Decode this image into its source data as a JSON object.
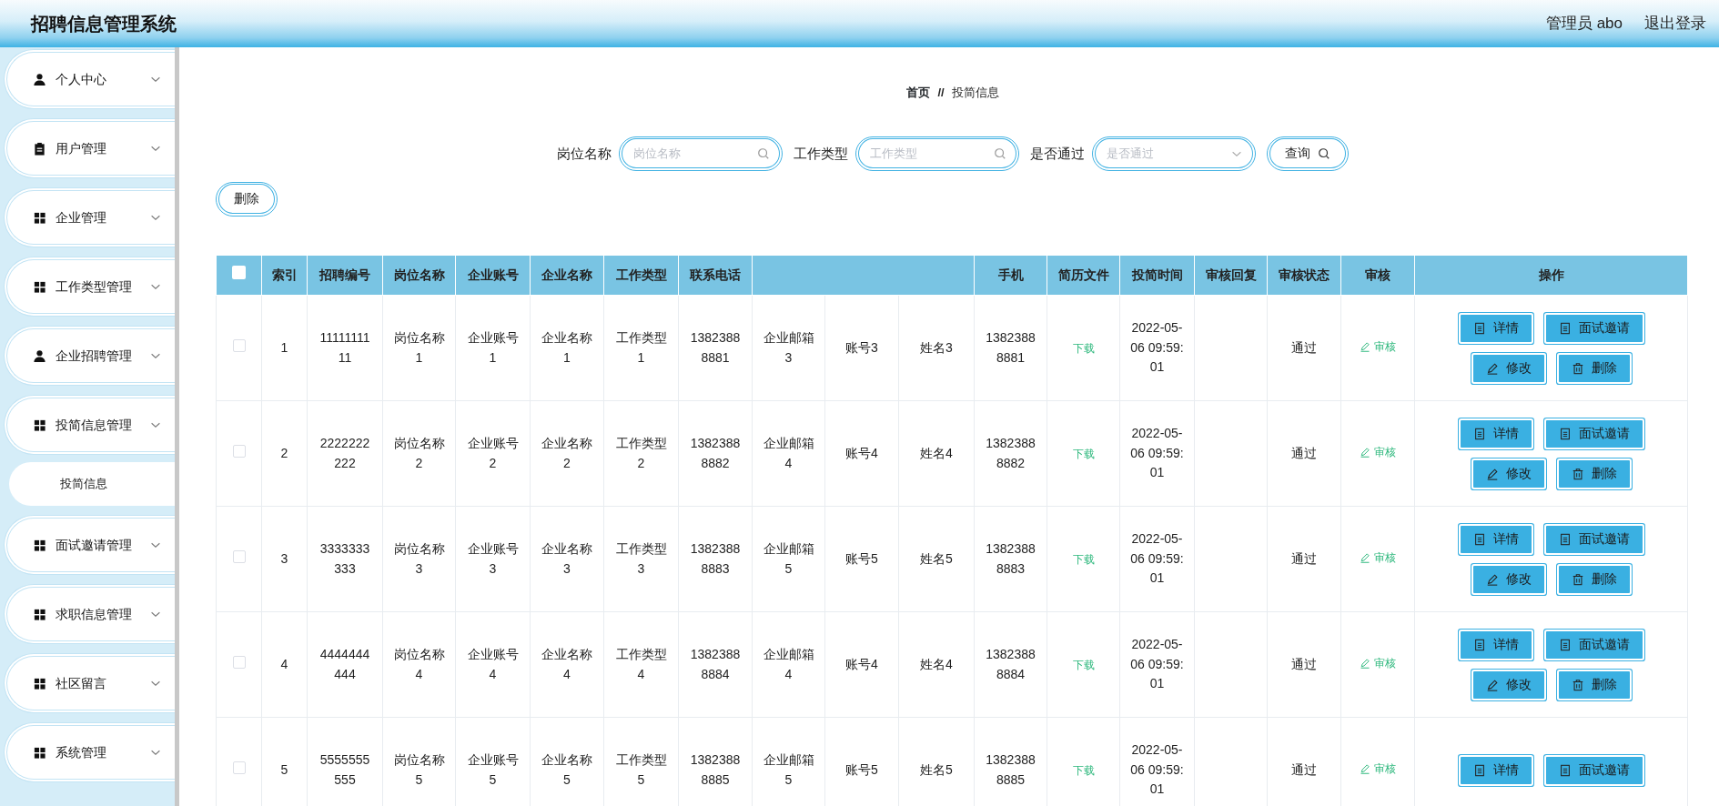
{
  "header": {
    "title": "招聘信息管理系统",
    "user": "管理员 abo",
    "logout": "退出登录"
  },
  "sidebar": {
    "items": [
      {
        "label": "个人中心"
      },
      {
        "label": "用户管理"
      },
      {
        "label": "企业管理"
      },
      {
        "label": "工作类型管理"
      },
      {
        "label": "企业招聘管理"
      },
      {
        "label": "投简信息管理",
        "children": [
          {
            "label": "投简信息",
            "selected": true
          }
        ]
      },
      {
        "label": "面试邀请管理"
      },
      {
        "label": "求职信息管理"
      },
      {
        "label": "社区留言"
      },
      {
        "label": "系统管理"
      }
    ]
  },
  "breadcrumb": {
    "home": "首页",
    "separator": "//",
    "current": "投简信息"
  },
  "search": {
    "fields": [
      {
        "label": "岗位名称",
        "placeholder": "岗位名称",
        "kind": "text"
      },
      {
        "label": "工作类型",
        "placeholder": "工作类型",
        "kind": "text"
      },
      {
        "label": "是否通过",
        "placeholder": "是否通过",
        "kind": "select"
      }
    ],
    "button": "查询"
  },
  "delete_button": "删除",
  "table": {
    "select_all": {
      "checked": false
    },
    "columns": [
      "索引",
      "招聘编号",
      "岗位名称",
      "企业账号",
      "企业名称",
      "工作类型",
      "联系电话",
      "",
      "",
      "",
      "手机",
      "简历文件",
      "投简时间",
      "审核回复",
      "审核状态",
      "审核",
      "操作"
    ],
    "rows": [
      {
        "checked": false,
        "cells": [
          "1",
          "1111111111",
          "岗位名称1",
          "企业账号1",
          "企业名称1",
          "工作类型1",
          "13823888881",
          "企业邮箱3",
          "账号3",
          "姓名3",
          "13823888881",
          "下载",
          "2022-05-06 09:59:01",
          "",
          "通过",
          "审核"
        ],
        "actions": [
          "详情",
          "面试邀请",
          "修改",
          "删除"
        ]
      },
      {
        "checked": false,
        "cells": [
          "2",
          "2222222222",
          "岗位名称2",
          "企业账号2",
          "企业名称2",
          "工作类型2",
          "13823888882",
          "企业邮箱4",
          "账号4",
          "姓名4",
          "13823888882",
          "下载",
          "2022-05-06 09:59:01",
          "",
          "通过",
          "审核"
        ],
        "actions": [
          "详情",
          "面试邀请",
          "修改",
          "删除"
        ]
      },
      {
        "checked": false,
        "cells": [
          "3",
          "3333333333",
          "岗位名称3",
          "企业账号3",
          "企业名称3",
          "工作类型3",
          "13823888883",
          "企业邮箱5",
          "账号5",
          "姓名5",
          "13823888883",
          "下载",
          "2022-05-06 09:59:01",
          "",
          "通过",
          "审核"
        ],
        "actions": [
          "详情",
          "面试邀请",
          "修改",
          "删除"
        ]
      },
      {
        "checked": false,
        "cells": [
          "4",
          "4444444444",
          "岗位名称4",
          "企业账号4",
          "企业名称4",
          "工作类型4",
          "13823888884",
          "企业邮箱4",
          "账号4",
          "姓名4",
          "13823888884",
          "下载",
          "2022-05-06 09:59:01",
          "",
          "通过",
          "审核"
        ],
        "actions": [
          "详情",
          "面试邀请",
          "修改",
          "删除"
        ]
      },
      {
        "checked": false,
        "cells": [
          "5",
          "5555555555",
          "岗位名称5",
          "企业账号5",
          "企业名称5",
          "工作类型5",
          "13823888885",
          "企业邮箱5",
          "账号5",
          "姓名5",
          "13823888885",
          "下载",
          "2022-05-06 09:59:01",
          "",
          "通过",
          "审核"
        ],
        "actions": [
          "详情",
          "面试邀请"
        ]
      }
    ]
  }
}
